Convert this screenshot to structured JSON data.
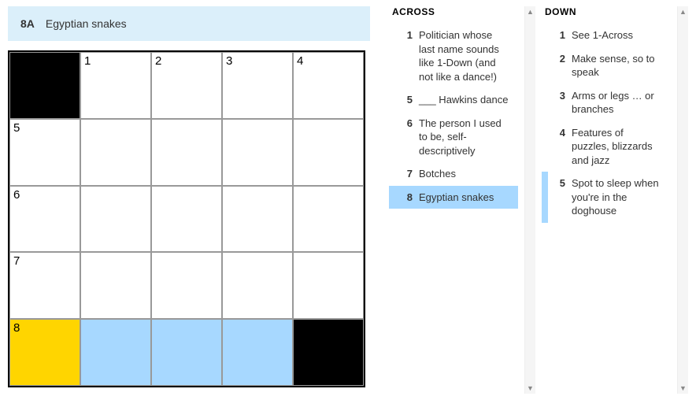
{
  "current_clue": {
    "label": "8A",
    "text": "Egyptian snakes"
  },
  "grid": {
    "rows": 5,
    "cols": 5,
    "cells": [
      [
        {
          "black": true
        },
        {
          "num": "1"
        },
        {
          "num": "2"
        },
        {
          "num": "3"
        },
        {
          "num": "4"
        }
      ],
      [
        {
          "num": "5"
        },
        {},
        {},
        {},
        {}
      ],
      [
        {
          "num": "6"
        },
        {},
        {},
        {},
        {}
      ],
      [
        {
          "num": "7"
        },
        {},
        {},
        {},
        {}
      ],
      [
        {
          "num": "8",
          "cursor": true
        },
        {
          "hl": true
        },
        {
          "hl": true
        },
        {
          "hl": true
        },
        {
          "black": true
        }
      ]
    ]
  },
  "across_title": "ACROSS",
  "down_title": "DOWN",
  "across": [
    {
      "num": "1",
      "text": "Politician whose last name sounds like 1-Down (and not like a dance!)"
    },
    {
      "num": "5",
      "text": "___ Hawkins dance"
    },
    {
      "num": "6",
      "text": "The person I used to be, self-descriptively"
    },
    {
      "num": "7",
      "text": "Botches"
    },
    {
      "num": "8",
      "text": "Egyptian snakes",
      "selected": true
    }
  ],
  "down": [
    {
      "num": "1",
      "text": "See 1-Across"
    },
    {
      "num": "2",
      "text": "Make sense, so to speak"
    },
    {
      "num": "3",
      "text": "Arms or legs … or branches"
    },
    {
      "num": "4",
      "text": "Features of puzzles, blizzards and jazz"
    },
    {
      "num": "5",
      "text": "Spot to sleep when you're in the doghouse",
      "related": true
    }
  ]
}
